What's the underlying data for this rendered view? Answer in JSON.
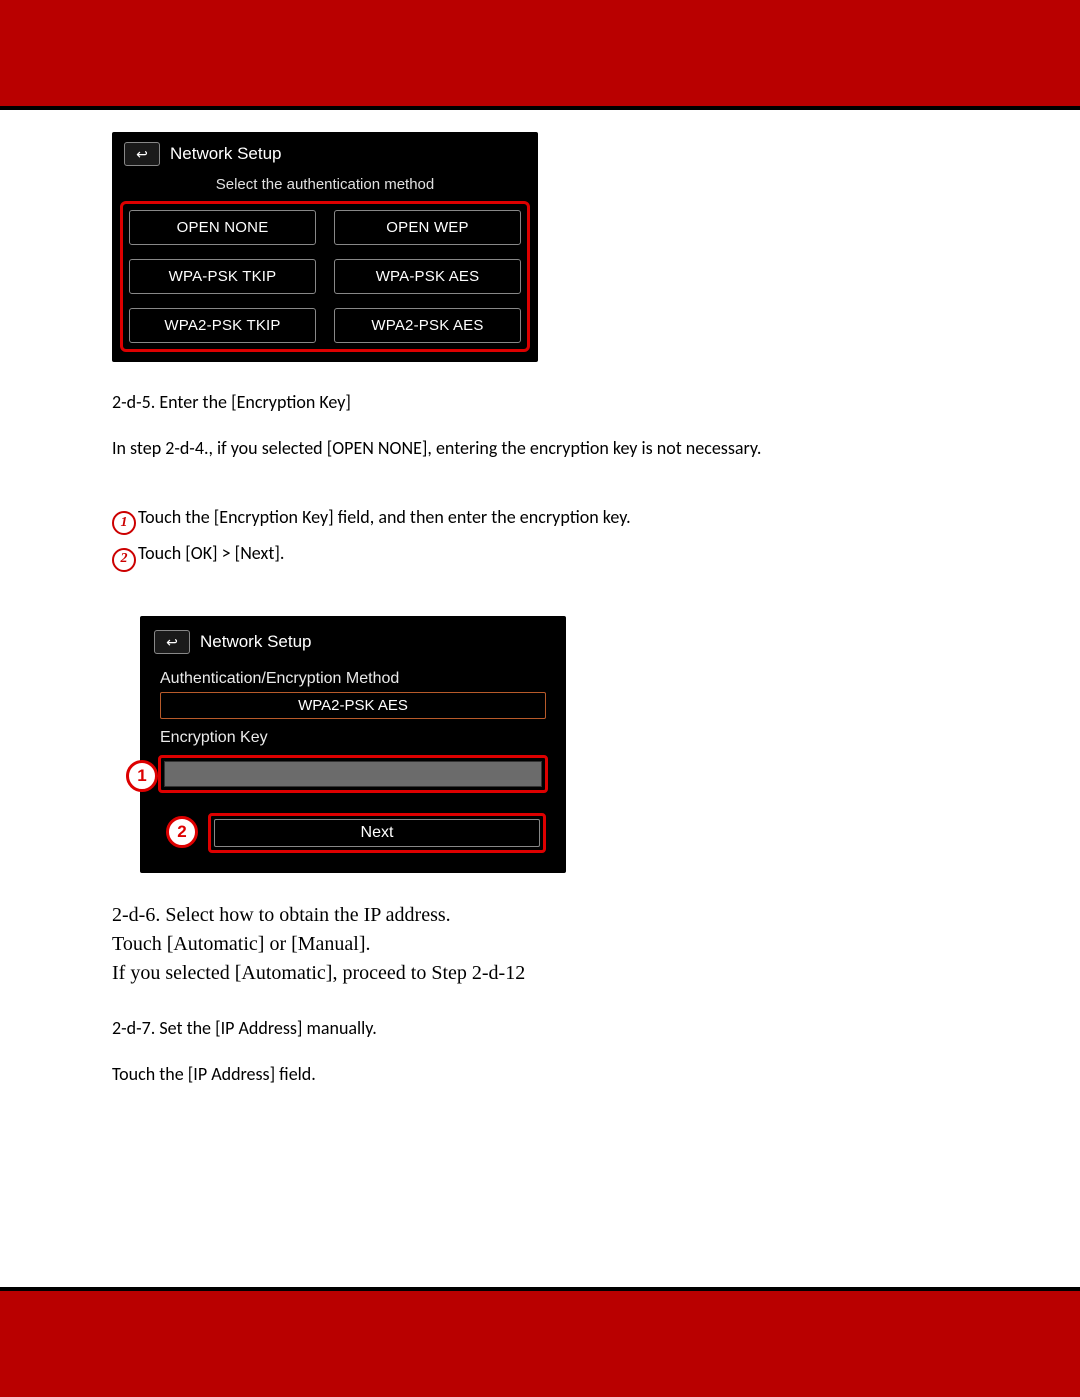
{
  "shot1": {
    "title": "Network Setup",
    "subtitle": "Select the authentication method",
    "buttons": [
      "OPEN NONE",
      "OPEN WEP",
      "WPA-PSK TKIP",
      "WPA-PSK AES",
      "WPA2-PSK TKIP",
      "WPA2-PSK AES"
    ]
  },
  "text": {
    "step_2d5": "2-d-5. Enter the [Encryption Key]",
    "step_2d5_note": "In step 2-d-4., if you selected [OPEN NONE], entering the encryption key is not necessary.",
    "bullet1": "Touch the [Encryption Key] field, and then enter the encryption key.",
    "bullet2": "Touch [OK] > [Next].",
    "step_2d6_line1": "2-d-6. Select how to obtain the IP address.",
    "step_2d6_line2": "Touch [Automatic] or [Manual].",
    "step_2d6_line3": "If you selected [Automatic], proceed to Step 2-d-12",
    "step_2d7": "2-d-7. Set the [IP Address] manually.",
    "step_2d7_note": "Touch the [IP Address] field."
  },
  "markers": {
    "one": "1",
    "two": "2"
  },
  "shot2": {
    "title": "Network Setup",
    "section1_label": "Authentication/Encryption Method",
    "section1_value": "WPA2-PSK AES",
    "section2_label": "Encryption Key",
    "next_label": "Next"
  }
}
